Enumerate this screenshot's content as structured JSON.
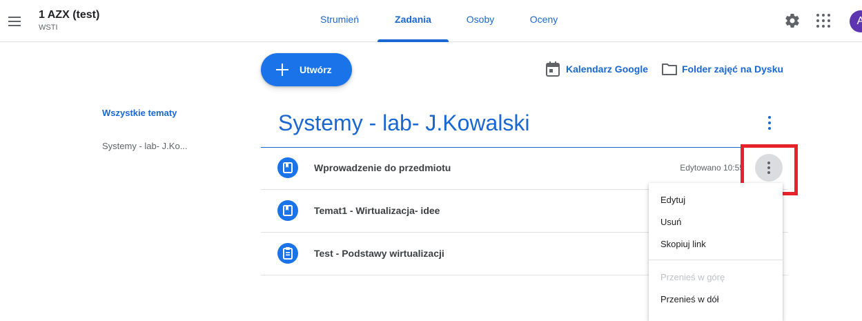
{
  "header": {
    "class_title": "1 AZX (test)",
    "class_subtitle": "WSTI",
    "tabs": [
      {
        "label": "Strumień"
      },
      {
        "label": "Zadania"
      },
      {
        "label": "Osoby"
      },
      {
        "label": "Oceny"
      }
    ],
    "active_tab": "Zadania",
    "avatar_letter": "A",
    "icons": [
      "menu-icon",
      "gear-icon",
      "apps-grid-icon"
    ]
  },
  "toolbar": {
    "create_label": "Utwórz",
    "calendar_label": "Kalendarz Google",
    "drive_label": "Folder zajęć na Dysku"
  },
  "sidebar": {
    "items": [
      {
        "label": "Wszystkie tematy"
      },
      {
        "label": "Systemy - lab- J.Ko..."
      }
    ]
  },
  "topic": {
    "title": "Systemy - lab- J.Kowalski",
    "items": [
      {
        "title": "Wprowadzenie do przedmiotu",
        "icon": "material-icon",
        "meta": "Edytowano 10:55"
      },
      {
        "title": "Temat1 - Wirtualizacja- idee",
        "icon": "material-icon",
        "meta": ""
      },
      {
        "title": "Test - Podstawy wirtualizacji",
        "icon": "assignment-icon",
        "meta": ""
      }
    ]
  },
  "context_menu": {
    "items": [
      {
        "label": "Edytuj",
        "enabled": true
      },
      {
        "label": "Usuń",
        "enabled": true
      },
      {
        "label": "Skopiuj link",
        "enabled": true
      },
      {
        "label": "Przenieś w górę",
        "enabled": false
      },
      {
        "label": "Przenieś w dół",
        "enabled": true
      }
    ]
  },
  "colors": {
    "accent": "#1967d2",
    "button": "#1a73e8",
    "highlight": "#e8222a",
    "avatar": "#5e35b1"
  }
}
